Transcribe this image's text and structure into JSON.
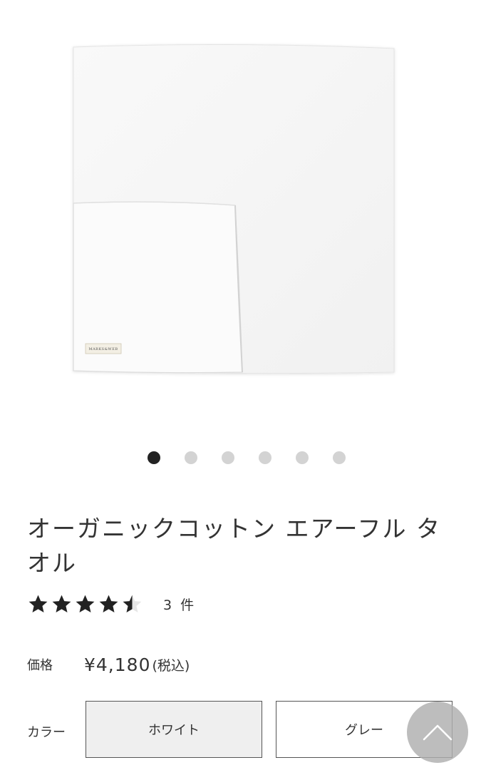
{
  "product": {
    "title": "オーガニックコットン エアーフル タオル",
    "image_alt": "白いタオル",
    "tag_text": "MARKS&WEB"
  },
  "gallery": {
    "slide_count": 6,
    "active_index": 0
  },
  "rating": {
    "value": 4.5,
    "max": 5,
    "count_text": "3 件"
  },
  "price": {
    "label": "価格",
    "value": "¥4,180",
    "tax_note": "(税込)"
  },
  "color": {
    "label": "カラー",
    "options": [
      {
        "label": "ホワイト",
        "selected": true
      },
      {
        "label": "グレー",
        "selected": false
      }
    ]
  },
  "colors": {
    "text": "#333333",
    "dot_active": "#222222",
    "dot_inactive": "#d3d3d3",
    "selected_bg": "#efefef",
    "scroll_button": "#afafaf"
  },
  "icons": {
    "star": "star-icon",
    "scroll_top": "chevron-up-icon"
  }
}
